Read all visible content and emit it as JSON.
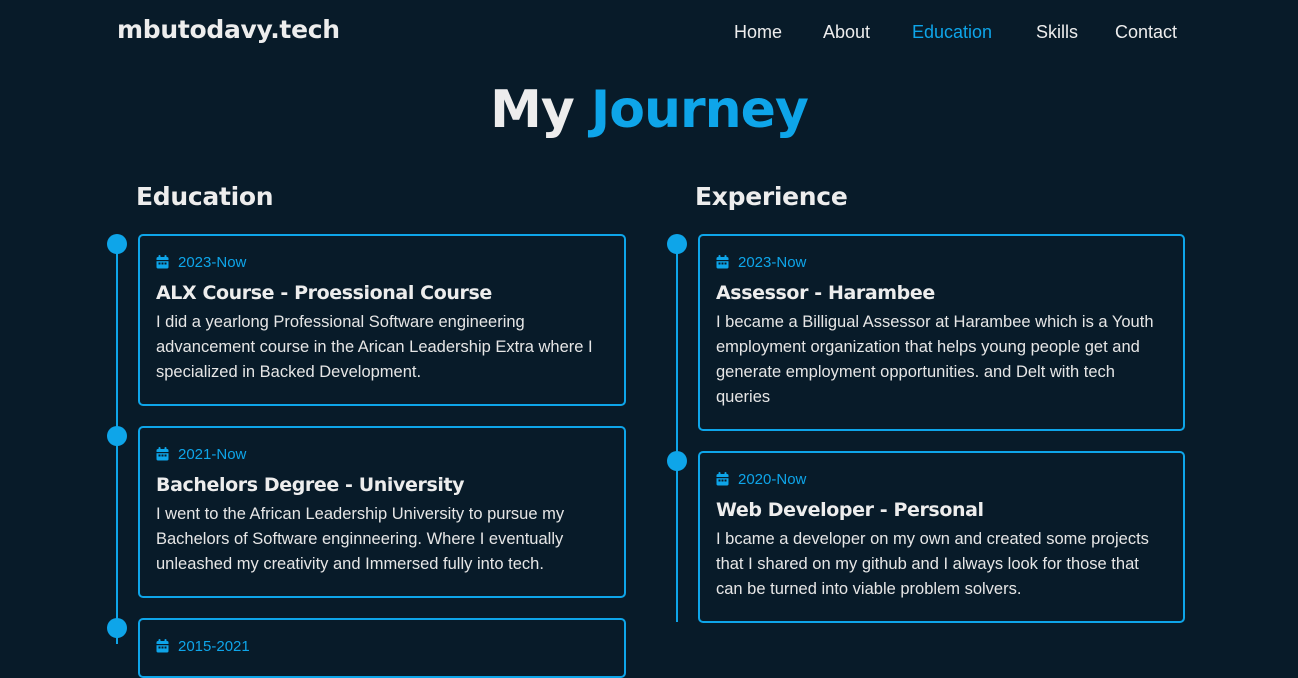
{
  "header": {
    "logo": "mbutodavy.tech",
    "nav": [
      {
        "label": "Home",
        "active": false
      },
      {
        "label": "About",
        "active": false
      },
      {
        "label": "Education",
        "active": true
      },
      {
        "label": "Skills",
        "active": false
      },
      {
        "label": "Contact",
        "active": false
      }
    ]
  },
  "page": {
    "title_plain": "My",
    "title_accent": "Journey"
  },
  "education": {
    "heading": "Education",
    "items": [
      {
        "date": "2023-Now",
        "title": "ALX Course - Proessional Course",
        "description": "I did a yearlong Professional Software engineering advancement course in the Arican Leadership Extra where I specialized in Backed Development."
      },
      {
        "date": "2021-Now",
        "title": "Bachelors Degree - University",
        "description": "I went to the African Leadership University to pursue my Bachelors of Software enginneering. Where I eventually unleashed my creativity and Immersed fully into tech."
      },
      {
        "date": "2015-2021",
        "title": "",
        "description": ""
      }
    ]
  },
  "experience": {
    "heading": "Experience",
    "items": [
      {
        "date": "2023-Now",
        "title": "Assessor - Harambee",
        "description": "I became a Billigual Assessor at Harambee which is a Youth employment organization that helps young people get and generate employment opportunities. and Delt with tech queries"
      },
      {
        "date": "2020-Now",
        "title": "Web Developer - Personal",
        "description": "I bcame a developer on my own and created some projects that I shared on my github and I always look for those that can be turned into viable problem solvers."
      }
    ]
  },
  "colors": {
    "background": "#081b29",
    "accent": "#0ea5e9",
    "text": "#ededed"
  },
  "icons": {
    "date": "calendar-icon"
  }
}
